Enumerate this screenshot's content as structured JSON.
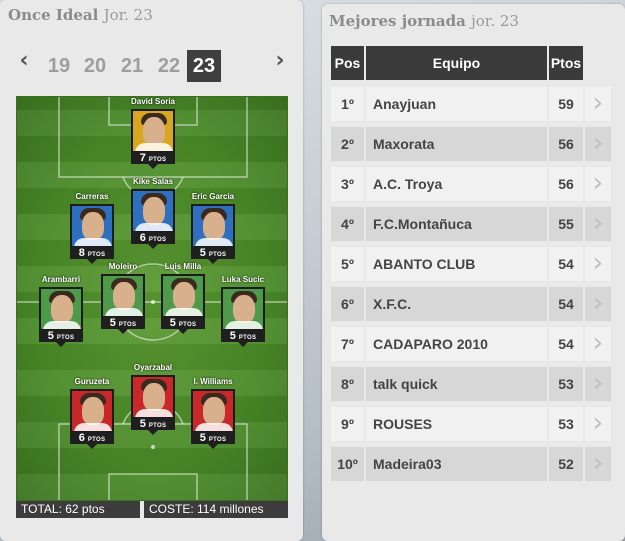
{
  "once_ideal": {
    "title": "Once Ideal",
    "jornada_label": "Jor. 23",
    "jornadas": [
      "19",
      "20",
      "21",
      "22",
      "23"
    ],
    "active_jornada": "23",
    "prev_arrow": "‹",
    "next_arrow": "›",
    "players": [
      {
        "name": "David Soria",
        "points": "7",
        "card_color": "yellow"
      },
      {
        "name": "Kike Salas",
        "points": "6",
        "card_color": "blue"
      },
      {
        "name": "Carreras",
        "points": "8",
        "card_color": "blue"
      },
      {
        "name": "Eric Garcia",
        "points": "5",
        "card_color": "blue"
      },
      {
        "name": "Arambarri",
        "points": "5",
        "card_color": "green"
      },
      {
        "name": "Moleiro",
        "points": "5",
        "card_color": "green"
      },
      {
        "name": "Luis Milla",
        "points": "5",
        "card_color": "green"
      },
      {
        "name": "Luka Sucic",
        "points": "5",
        "card_color": "green"
      },
      {
        "name": "Oyarzabal",
        "points": "5",
        "card_color": "red"
      },
      {
        "name": "Guruzeta",
        "points": "6",
        "card_color": "red"
      },
      {
        "name": "I. Williams",
        "points": "5",
        "card_color": "red"
      }
    ],
    "pts_unit": "PTOS",
    "total": "TOTAL: 62 ptos",
    "cost": "COSTE: 114 millones"
  },
  "mejores_jornada": {
    "title": "Mejores jornada",
    "jornada_label": "jor. 23",
    "headers": {
      "pos": "Pos",
      "team": "Equipo",
      "pts": "Ptos"
    },
    "rows": [
      {
        "pos": "1º",
        "team": "Anayjuan",
        "pts": "59"
      },
      {
        "pos": "2º",
        "team": "Maxorata",
        "pts": "56"
      },
      {
        "pos": "3º",
        "team": "A.C. Troya",
        "pts": "56"
      },
      {
        "pos": "4º",
        "team": "F.C.Montañuca",
        "pts": "55"
      },
      {
        "pos": "5º",
        "team": "ABANTO CLUB",
        "pts": "54"
      },
      {
        "pos": "6º",
        "team": "X.F.C.",
        "pts": "54"
      },
      {
        "pos": "7º",
        "team": "CADAPARO 2010",
        "pts": "54"
      },
      {
        "pos": "8º",
        "team": "talk quick",
        "pts": "53"
      },
      {
        "pos": "9º",
        "team": "ROUSES",
        "pts": "53"
      },
      {
        "pos": "10º",
        "team": "Madeira03",
        "pts": "52"
      }
    ],
    "row_arrow": "›"
  },
  "colors": {
    "card_yellow": "#d9a620",
    "card_blue": "#2e6fbf",
    "card_green": "#4e9a4a",
    "card_red": "#c8282a",
    "header_dark": "#3a3a3a",
    "pitch_green": "#4a8a28"
  }
}
